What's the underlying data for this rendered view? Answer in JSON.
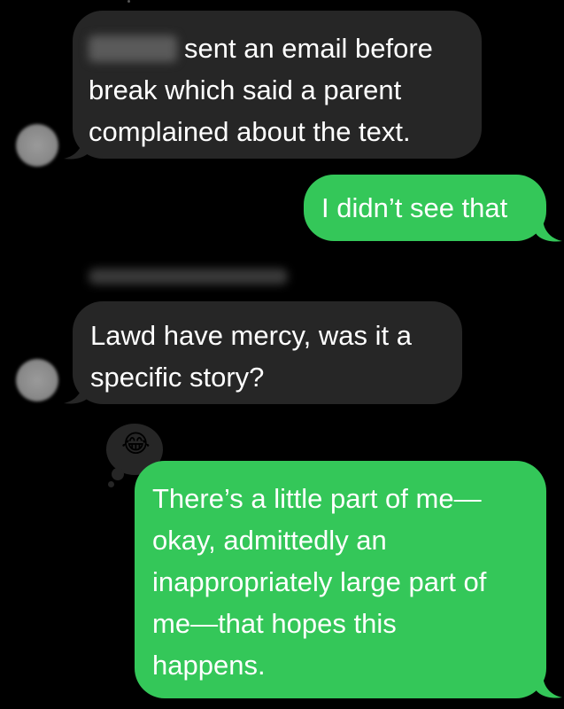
{
  "messages": [
    {
      "direction": "incoming",
      "sender_redacted": true,
      "text": "sent an email before\nbreak which said a parent\ncomplained about the text."
    },
    {
      "direction": "outgoing",
      "text": "I didn’t see that"
    },
    {
      "direction": "incoming",
      "sender_label_redacted": true,
      "text": "Lawd have mercy, was it a\nspecific story?"
    },
    {
      "direction": "outgoing",
      "reaction": "😂",
      "text": "There’s a little part of me—\nokay, admittedly an\ninappropriately large part of\nme—that hopes this\nhappens."
    }
  ],
  "colors": {
    "background": "#000000",
    "incoming_bubble": "#262626",
    "outgoing_bubble": "#34c759",
    "text": "#ffffff"
  },
  "icons": {
    "avatar": "contact-avatar-blurred",
    "reaction": "laughing-emoji-icon"
  }
}
